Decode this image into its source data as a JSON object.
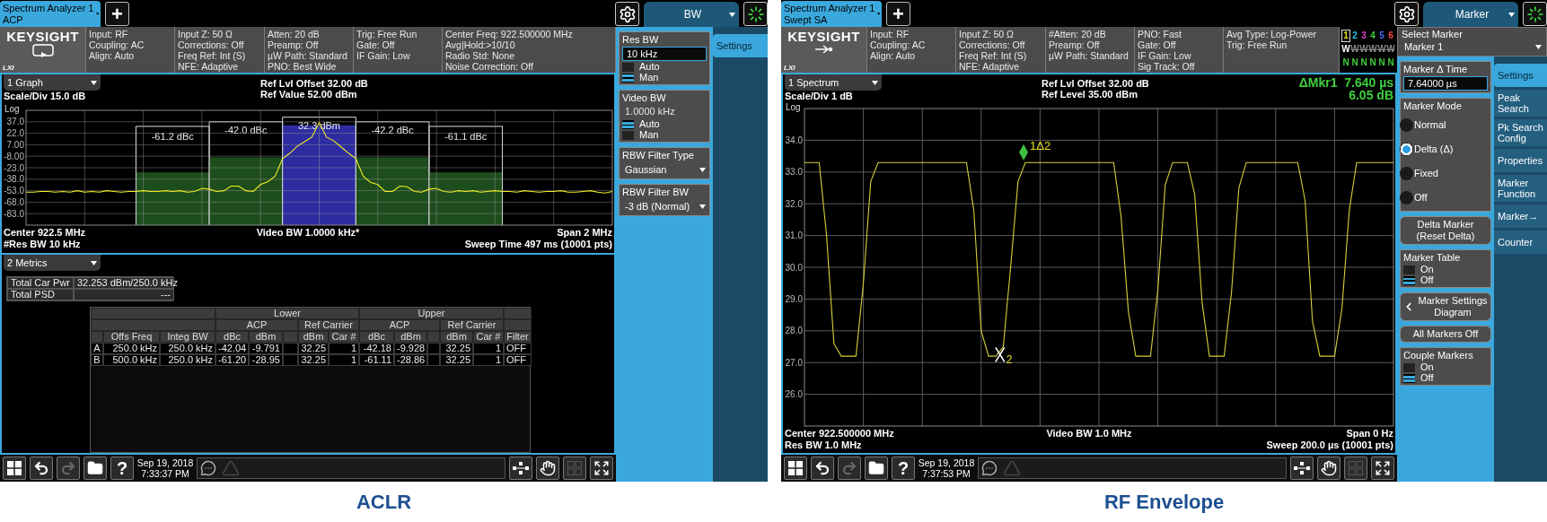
{
  "screens": [
    {
      "kind": "aclr",
      "instrument_tab": {
        "title": "Spectrum Analyzer 1",
        "mode": "ACP"
      },
      "add_tab": "+",
      "menu_title": "BW",
      "brand": {
        "name": "KEYSIGHT",
        "badge": "LXI"
      },
      "settings": [
        [
          "Input: RF",
          "Coupling: AC",
          "Align: Auto"
        ],
        [
          "Input Z: 50 Ω",
          "Corrections: Off",
          "Freq Ref: Int (S)",
          "NFE: Adaptive"
        ],
        [
          "Atten: 20 dB",
          "Preamp: Off",
          "µW Path: Standard",
          "PNO: Best Wide"
        ],
        [
          "Trig: Free Run",
          "Gate: Off",
          "IF Gain: Low"
        ],
        [
          "Center Freq: 922.500000 MHz",
          "Avg|Hold:>10/10",
          "Radio Std: None",
          "Noise Correction: Off"
        ]
      ],
      "view": "1 Graph",
      "ref": [
        "Ref Lvl Offset 32.00 dB",
        "Ref Value 52.00 dBm"
      ],
      "scale": "Scale/Div 15.0 dB",
      "scale_type": "Log",
      "chart_data": {
        "type": "line",
        "grid": true,
        "ylim": [
          -98,
          52
        ],
        "yticks": [
          {
            "value": 37,
            "label": "37.0"
          },
          {
            "value": 22,
            "label": "22.0"
          },
          {
            "value": 7,
            "label": "7.00"
          },
          {
            "value": -8,
            "label": "-8.00"
          },
          {
            "value": -23,
            "label": "-23.0"
          },
          {
            "value": -38,
            "label": "-38.0"
          },
          {
            "value": -53,
            "label": "-53.0"
          },
          {
            "value": -68,
            "label": "-68.0"
          },
          {
            "value": -83,
            "label": "-83.0"
          }
        ],
        "series": [
          {
            "color": "#f2ef22",
            "values": [
              -55,
              -55,
              -54,
              -54,
              -55,
              -54,
              -55,
              -53,
              -55,
              -54,
              -55,
              -53,
              -54,
              -55,
              -54,
              -54,
              -53,
              -54,
              -54,
              -53,
              -54,
              -53,
              -55,
              -54,
              -50,
              -51,
              -54,
              -53,
              -47,
              -47,
              -53,
              -54,
              -45,
              -41,
              -34,
              -11,
              -4,
              5,
              11,
              17,
              36,
              17,
              12,
              4,
              -4,
              -11,
              -34,
              -42,
              -45,
              -54,
              -54,
              -47,
              -48,
              -54,
              -55,
              -51,
              -50,
              -54,
              -55,
              -53,
              -54,
              -53,
              -55,
              -54,
              -53,
              -54,
              -54,
              -55,
              -53,
              -54,
              -55,
              -54,
              -54,
              -53,
              -55,
              -55,
              -54,
              -53,
              -55,
              -56,
              -54
            ]
          }
        ]
      },
      "channels": [
        {
          "label": "-61.2 dBc",
          "kind": "offset"
        },
        {
          "label": "-42.0 dBc",
          "kind": "offset"
        },
        {
          "label": "32.3 dBm",
          "kind": "carrier"
        },
        {
          "label": "-42.2 dBc",
          "kind": "offset"
        },
        {
          "label": "-61.1 dBc",
          "kind": "offset"
        }
      ],
      "footer": {
        "center": "Center 922.5 MHz",
        "video_bw": "Video BW 1.0000 kHz*",
        "span": "Span 2 MHz",
        "res_bw": "#Res BW 10 kHz",
        "sweep": "Sweep Time 497 ms (10001 pts)"
      },
      "metrics": {
        "view": "2 Metrics",
        "summary": [
          {
            "name": "Total Car Pwr",
            "value": "32.253 dBm/250.0 kHz"
          },
          {
            "name": "Total PSD",
            "value": "---"
          }
        ],
        "table": {
          "groups": [
            "Lower",
            "Upper"
          ],
          "subgroups": [
            "ACP",
            "Ref Carrier",
            "ACP",
            "Ref Carrier"
          ],
          "columns": [
            "Offs Freq",
            "Integ BW",
            "dBc",
            "dBm",
            "dBm",
            "Car #",
            "dBc",
            "dBm",
            "dBm",
            "Car #",
            "Filter"
          ],
          "rows": [
            {
              "label": "A",
              "cells": [
                "250.0 kHz",
                "250.0 kHz",
                "-42.04",
                "-9.791",
                "32.25",
                "1",
                "-42.18",
                "-9.928",
                "32.25",
                "1",
                "OFF"
              ]
            },
            {
              "label": "B",
              "cells": [
                "500.0 kHz",
                "250.0 kHz",
                "-61.20",
                "-28.95",
                "32.25",
                "1",
                "-61.11",
                "-28.86",
                "32.25",
                "1",
                "OFF"
              ]
            }
          ]
        }
      },
      "controls": [
        {
          "kind": "entry",
          "label": "Res BW",
          "value": "10 kHz",
          "options": [
            {
              "label": "Auto",
              "selected": false
            },
            {
              "label": "Man",
              "selected": true
            }
          ]
        },
        {
          "kind": "readout",
          "label": "Video BW",
          "value": "1.0000 kHz",
          "options": [
            {
              "label": "Auto",
              "selected": true
            },
            {
              "label": "Man",
              "selected": false
            }
          ]
        },
        {
          "kind": "dropdown",
          "label": "RBW Filter Type",
          "value": "Gaussian"
        },
        {
          "kind": "dropdown",
          "label": "RBW Filter BW",
          "value": "-3 dB (Normal)"
        }
      ],
      "tabs": [
        {
          "label": "Settings",
          "selected": true
        }
      ],
      "taskbar": {
        "help": "?",
        "date": "Sep 19, 2018",
        "time": "7:33:37 PM",
        "redo_disabled": true
      },
      "caption": "ACLR"
    },
    {
      "kind": "envelope",
      "instrument_tab": {
        "title": "Spectrum Analyzer 1",
        "mode": "Swept SA"
      },
      "add_tab": "+",
      "menu_title": "Marker",
      "brand": {
        "name": "KEYSIGHT",
        "badge": "LXI"
      },
      "settings": [
        [
          "Input: RF",
          "Coupling: AC",
          "Align: Auto"
        ],
        [
          "Input Z: 50 Ω",
          "Corrections: Off",
          "Freq Ref: Int (S)",
          "NFE: Adaptive"
        ],
        [
          "#Atten: 20 dB",
          "Preamp: Off",
          "µW Path: Standard"
        ],
        [
          "PNO: Fast",
          "Gate: Off",
          "IF Gain: Low",
          "Sig Track: Off"
        ],
        [
          "Avg Type: Log-Power",
          "Trig: Free Run"
        ]
      ],
      "trace_legend": [
        {
          "number": "1",
          "color": "#e8e020",
          "selected": true,
          "mode": "W",
          "mode_active": true,
          "detector": "N"
        },
        {
          "number": "2",
          "color": "#22c8e8",
          "selected": false,
          "mode": "W",
          "mode_active": false,
          "detector": "N"
        },
        {
          "number": "3",
          "color": "#e040c8",
          "selected": false,
          "mode": "W",
          "mode_active": false,
          "detector": "N"
        },
        {
          "number": "4",
          "color": "#40d040",
          "selected": false,
          "mode": "W",
          "mode_active": false,
          "detector": "N"
        },
        {
          "number": "5",
          "color": "#4a6cff",
          "selected": false,
          "mode": "W",
          "mode_active": false,
          "detector": "N"
        },
        {
          "number": "6",
          "color": "#ff4a4a",
          "selected": false,
          "mode": "W",
          "mode_active": false,
          "detector": "N"
        }
      ],
      "view": "1 Spectrum",
      "ref": [
        "Ref Lvl Offset 32.00 dB",
        "Ref Level 35.00 dBm"
      ],
      "scale": "Scale/Div 1 dB",
      "scale_type": "Log",
      "marker_readout": [
        "ΔMkr1  7.640 µs",
        "6.05 dB"
      ],
      "chart_data": {
        "type": "line",
        "grid": true,
        "ylim": [
          25,
          35
        ],
        "yticks": [
          {
            "value": 34,
            "label": "34.0"
          },
          {
            "value": 33,
            "label": "33.0"
          },
          {
            "value": 32,
            "label": "32.0"
          },
          {
            "value": 31,
            "label": "31.0"
          },
          {
            "value": 30,
            "label": "30.0"
          },
          {
            "value": 29,
            "label": "29.0"
          },
          {
            "value": 28,
            "label": "28.0"
          },
          {
            "value": 27,
            "label": "27.0"
          },
          {
            "value": 26,
            "label": "26.0"
          }
        ],
        "series": [
          {
            "color": "#d6d03a",
            "values": [
              33.3,
              33.3,
              33.3,
              31.0,
              27.6,
              27.2,
              27.2,
              27.2,
              29.5,
              32.7,
              33.3,
              33.3,
              33.3,
              33.3,
              33.3,
              33.3,
              33.3,
              33.3,
              33.3,
              33.3,
              33.3,
              33.3,
              33.3,
              31.8,
              28.0,
              27.2,
              27.2,
              27.5,
              30.0,
              32.7,
              33.3,
              33.3,
              33.3,
              33.3,
              33.3,
              33.3,
              33.3,
              33.3,
              33.3,
              33.3,
              33.3,
              33.3,
              33.3,
              31.6,
              28.6,
              27.2,
              27.2,
              27.2,
              29.3,
              32.6,
              33.3,
              33.3,
              33.3,
              32.3,
              28.9,
              27.2,
              27.2,
              27.2,
              29.2,
              32.5,
              33.3,
              33.3,
              33.3,
              33.3,
              33.3,
              33.3,
              33.3,
              33.3,
              32.1,
              28.3,
              27.2,
              27.2,
              27.2,
              28.7,
              31.8,
              33.3,
              33.3,
              33.3,
              33.3,
              33.3,
              33.3
            ]
          }
        ]
      },
      "markers": [
        {
          "label": "1Δ2",
          "kind": "diamond"
        },
        {
          "label": "2",
          "kind": "cross"
        }
      ],
      "footer": {
        "center": "Center 922.500000 MHz",
        "video_bw": "Video BW 1.0 MHz",
        "span": "Span 0 Hz",
        "res_bw": "Res BW 1.0 MHz",
        "sweep": "Sweep 200.0 µs (10001 pts)"
      },
      "side_header": {
        "label": "Select Marker",
        "value": "Marker 1"
      },
      "controls": [
        {
          "kind": "entry",
          "label": "Marker Δ Time",
          "value": "7.64000 µs"
        },
        {
          "kind": "radio",
          "label": "Marker Mode",
          "options": [
            {
              "label": "Normal",
              "selected": false
            },
            {
              "label": "Delta (Δ)",
              "selected": true
            },
            {
              "label": "Fixed",
              "selected": false
            },
            {
              "label": "Off",
              "selected": false
            }
          ]
        },
        {
          "kind": "button",
          "label": "Delta Marker",
          "detail": "(Reset Delta)"
        },
        {
          "kind": "toggle",
          "label": "Marker Table",
          "options": [
            {
              "label": "On",
              "selected": false
            },
            {
              "label": "Off",
              "selected": true
            }
          ]
        },
        {
          "kind": "nav_button",
          "label": "Marker Settings Diagram"
        },
        {
          "kind": "button",
          "label": "All Markers Off"
        },
        {
          "kind": "toggle",
          "label": "Couple Markers",
          "options": [
            {
              "label": "On",
              "selected": false
            },
            {
              "label": "Off",
              "selected": true
            }
          ]
        }
      ],
      "tabs": [
        {
          "label": "Settings",
          "selected": true
        },
        {
          "label": "Peak Search",
          "selected": false
        },
        {
          "label": "Pk Search Config",
          "selected": false
        },
        {
          "label": "Properties",
          "selected": false
        },
        {
          "label": "Marker Function",
          "selected": false
        },
        {
          "label": "Marker→",
          "selected": false
        },
        {
          "label": "Counter",
          "selected": false
        }
      ],
      "taskbar": {
        "help": "?",
        "date": "Sep 19, 2018",
        "time": "7:37:53 PM",
        "redo_disabled": true
      },
      "caption": "RF Envelope"
    }
  ]
}
